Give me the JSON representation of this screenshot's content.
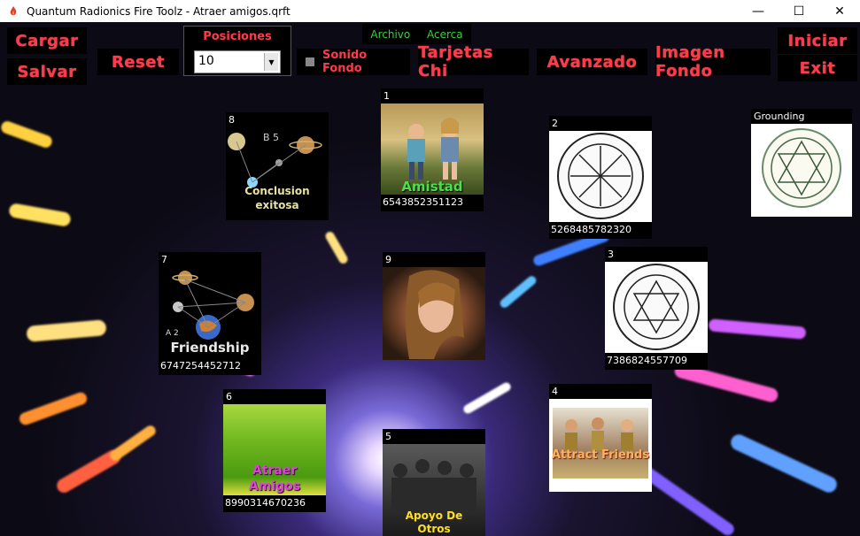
{
  "window": {
    "title": "Quantum Radionics Fire Toolz - Atraer amigos.qrft"
  },
  "window_controls": {
    "minimize": "—",
    "maximize": "☐",
    "close": "✕"
  },
  "buttons": {
    "cargar": "Cargar",
    "salvar": "Salvar",
    "reset": "Reset",
    "tarjetas_chi": "Tarjetas Chi",
    "avanzado": "Avanzado",
    "imagen_fondo": "Imagen Fondo",
    "iniciar": "Iniciar",
    "exit": "Exit"
  },
  "menu": {
    "archivo": "Archivo",
    "acerca": "Acerca"
  },
  "positions": {
    "label": "Posiciones",
    "value": "10"
  },
  "sonido_fondo": {
    "label": "Sonido Fondo",
    "checked": false
  },
  "cards": [
    {
      "num": "1",
      "caption": "Amistad",
      "code": "6543852351123"
    },
    {
      "num": "2",
      "code": "5268485782320"
    },
    {
      "num": "3",
      "code": "7386824557709"
    },
    {
      "num": "4",
      "caption": "Attract Friends"
    },
    {
      "num": "5",
      "caption": "Apoyo De Otros"
    },
    {
      "num": "6",
      "caption": "Atraer Amigos",
      "code": "8990314670236"
    },
    {
      "num": "7",
      "caption": "Friendship",
      "sub": "A 2",
      "code": "6747254452712"
    },
    {
      "num": "8",
      "caption": "Conclusion exitosa",
      "sub": "B 5"
    },
    {
      "num": "9"
    },
    {
      "num": "Grounding"
    }
  ],
  "colors": {
    "accent_red": "#ff3a4a",
    "menu_green": "#35d13a"
  }
}
